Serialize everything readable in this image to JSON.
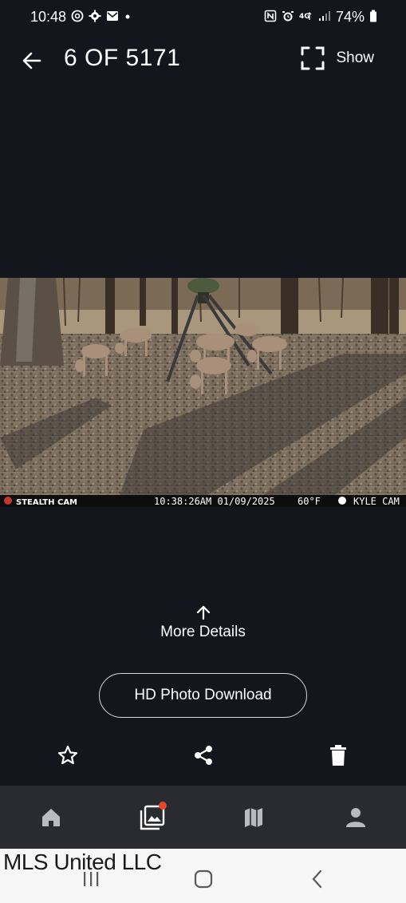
{
  "status_bar": {
    "time": "10:48",
    "left_icons": [
      "threads-icon",
      "gear-icon",
      "mail-icon",
      "dot"
    ],
    "right_icons": [
      "nfc-icon",
      "alarm-icon",
      "4g-icon",
      "signal-icon"
    ],
    "battery": "74%"
  },
  "header": {
    "counter": "6 OF 5171",
    "show_label": "Show"
  },
  "photo": {
    "brand": "STEALTH CAM",
    "timestamp": "10:38:26AM 01/09/2025",
    "temperature": "60°F",
    "camera_name": "KYLE CAM"
  },
  "details": {
    "label": "More Details"
  },
  "download": {
    "label": "HD Photo Download"
  },
  "actions": [
    "star-icon",
    "share-icon",
    "trash-icon"
  ],
  "bottom_nav": {
    "items": [
      "home",
      "gallery",
      "map",
      "profile"
    ],
    "active_badge_color": "#e8452c"
  },
  "watermark": "MLS United LLC"
}
